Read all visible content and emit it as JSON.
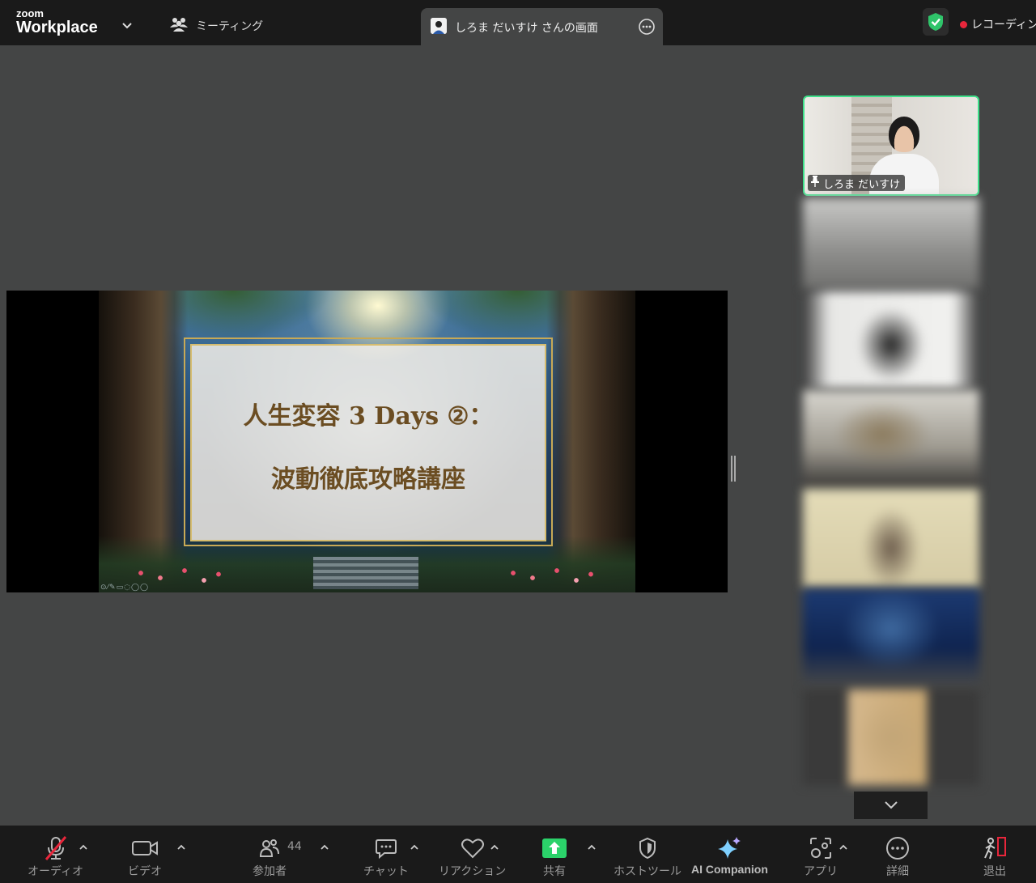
{
  "topbar": {
    "logo_small": "zoom",
    "logo_large": "Workplace",
    "meeting_label": "ミーティング",
    "share_tab_title": "しろま だいすけ さんの画面",
    "recording_label": "レコーディング"
  },
  "slide": {
    "line1": "人生変容 3 Days ②：",
    "line2": "波動徹底攻略講座"
  },
  "gallery": {
    "active_speaker_name": "しろま だいすけ"
  },
  "toolbar": {
    "audio": "オーディオ",
    "video": "ビデオ",
    "participants": "参加者",
    "participants_count": "44",
    "chat": "チャット",
    "reactions": "リアクション",
    "share": "共有",
    "host_tools": "ホストツール",
    "ai_companion": "AI Companion",
    "apps": "アプリ",
    "more": "詳細",
    "leave": "退出"
  },
  "colors": {
    "topbar_bg": "#1a1a1a",
    "stage_bg": "#444545",
    "active_speaker_border": "#3ee08a",
    "share_green": "#2bd26a",
    "mute_red": "#e8263b",
    "slide_text": "#6b4d22",
    "slide_frame": "#c8a956"
  }
}
